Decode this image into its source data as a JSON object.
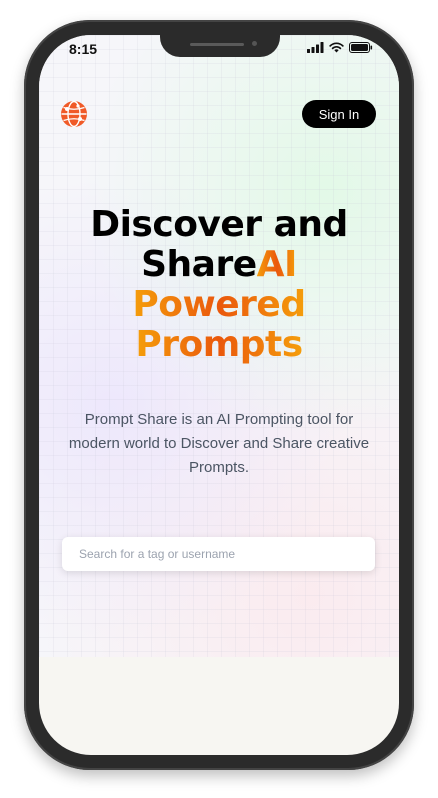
{
  "status_bar": {
    "time": "8:15"
  },
  "header": {
    "logo_icon": "globe-network-icon",
    "sign_in_label": "Sign In"
  },
  "hero": {
    "line1": "Discover and",
    "line2_plain": "Share",
    "line2_accent": "AI",
    "line3": "Powered",
    "line4": "Prompts",
    "description": "Prompt Share is an AI Prompting tool for modern world to Discover and Share creative Prompts.",
    "accent_gradient": [
      "#f59e0b",
      "#ea580c"
    ]
  },
  "search": {
    "placeholder": "Search for a tag or username",
    "value": ""
  }
}
